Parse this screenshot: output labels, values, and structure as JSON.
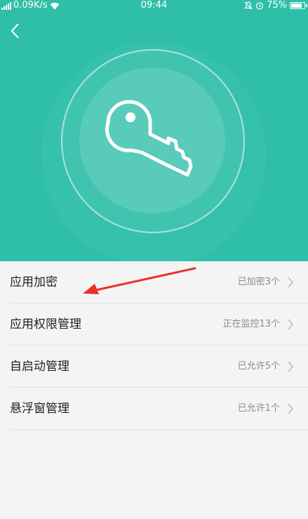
{
  "status_bar": {
    "network_speed": "0.09K/s",
    "time": "09:44",
    "battery": "75%",
    "icons": [
      "signal-icon",
      "wifi-icon",
      "mute-icon",
      "alarm-icon",
      "battery-icon"
    ]
  },
  "header": {
    "back_icon": "chevron-left-icon",
    "hero_icon": "key-icon",
    "accent_color": "#2fbfa9"
  },
  "menu": {
    "items": [
      {
        "label": "应用加密",
        "status": "已加密3个"
      },
      {
        "label": "应用权限管理",
        "status": "正在监控13个"
      },
      {
        "label": "自启动管理",
        "status": "已允许5个"
      },
      {
        "label": "悬浮窗管理",
        "status": "已允许1个"
      }
    ]
  },
  "annotation": {
    "arrow_color": "#e8322e"
  }
}
